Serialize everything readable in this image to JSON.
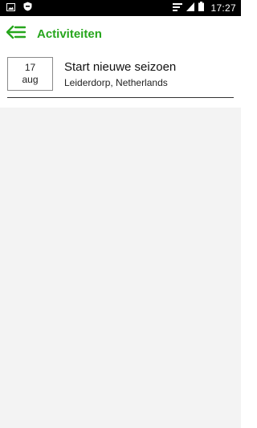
{
  "status_bar": {
    "time": "17:27",
    "icons": [
      "image-icon",
      "shield-icon",
      "cast-icon",
      "signal-icon",
      "battery-icon"
    ]
  },
  "app_bar": {
    "title": "Activiteiten",
    "menu_icon": "menu-back-icon",
    "accent_color": "#27a61d"
  },
  "activities": [
    {
      "day": "17",
      "month": "aug",
      "title": "Start nieuwe seizoen",
      "location": "Leiderdorp, Netherlands"
    }
  ]
}
